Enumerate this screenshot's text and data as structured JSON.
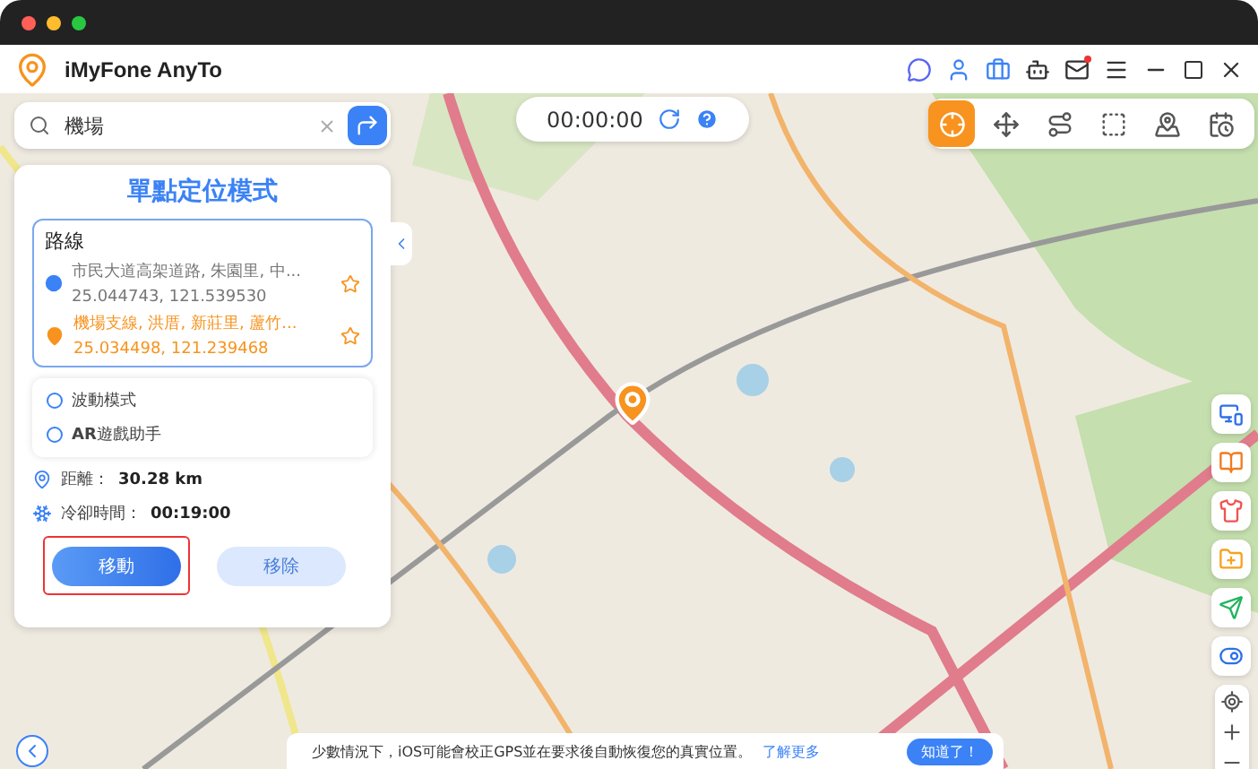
{
  "app": {
    "title": "iMyFone AnyTo",
    "mail_unread": true
  },
  "search": {
    "value": "機場"
  },
  "timer": {
    "time": "00:00:00"
  },
  "modes": [
    {
      "kind": "teleport",
      "selected": true
    },
    {
      "kind": "joystick",
      "selected": false
    },
    {
      "kind": "multi",
      "selected": false
    },
    {
      "kind": "area",
      "selected": false
    },
    {
      "kind": "jump",
      "selected": false
    },
    {
      "kind": "history",
      "selected": false
    }
  ],
  "panel": {
    "title": "單點定位模式",
    "route": {
      "label": "路線",
      "points": [
        {
          "kind": "start",
          "address": "市民大道高架道路, 朱園里, 中...",
          "coords": "25.044743, 121.539530"
        },
        {
          "kind": "destination",
          "address": "機場支線, 洪厝, 新莊里, 蘆竹...",
          "coords": "25.034498, 121.239468"
        }
      ]
    },
    "options": [
      {
        "label": "波動模式",
        "selected": false
      },
      {
        "label": "**AR**遊戲助手",
        "selected": false
      }
    ],
    "stats": [
      {
        "kind": "distance",
        "label": "距離：",
        "value": "30.28 km"
      },
      {
        "kind": "cooldown",
        "label": "冷卻時間：",
        "value": "00:19:00"
      }
    ],
    "buttons": [
      {
        "label": "移動",
        "disabled": false,
        "highlighted": true
      },
      {
        "label": "移除",
        "disabled": true,
        "highlighted": false
      }
    ]
  },
  "side_tools": [
    {
      "kind": "devices"
    },
    {
      "kind": "book"
    },
    {
      "kind": "shirt"
    },
    {
      "kind": "folder"
    },
    {
      "kind": "send"
    },
    {
      "kind": "toggle"
    }
  ],
  "banner": {
    "text": "少數情況下，iOS可能會校正GPS並在要求後自動恢復您的真實位置。",
    "link": "了解更多",
    "button": "知道了！"
  }
}
